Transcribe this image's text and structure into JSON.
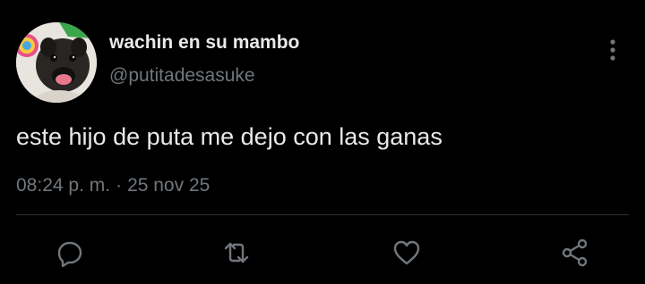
{
  "tweet": {
    "author": {
      "display_name": "wachin en su mambo",
      "handle": "@putitadesasuke"
    },
    "text": "este hijo de puta me dejo con las ganas",
    "time": "08:24 p. m.",
    "separator": "·",
    "date": "25 nov 25"
  },
  "actions": {
    "reply": "reply-icon",
    "retweet": "retweet-icon",
    "like": "heart-icon",
    "share": "share-icon",
    "more": "more-vertical-icon"
  },
  "colors": {
    "background": "#000000",
    "primary_text": "#e7e9ea",
    "secondary_text": "#71767b",
    "divider": "#2f3336",
    "icon": "#71767b"
  }
}
